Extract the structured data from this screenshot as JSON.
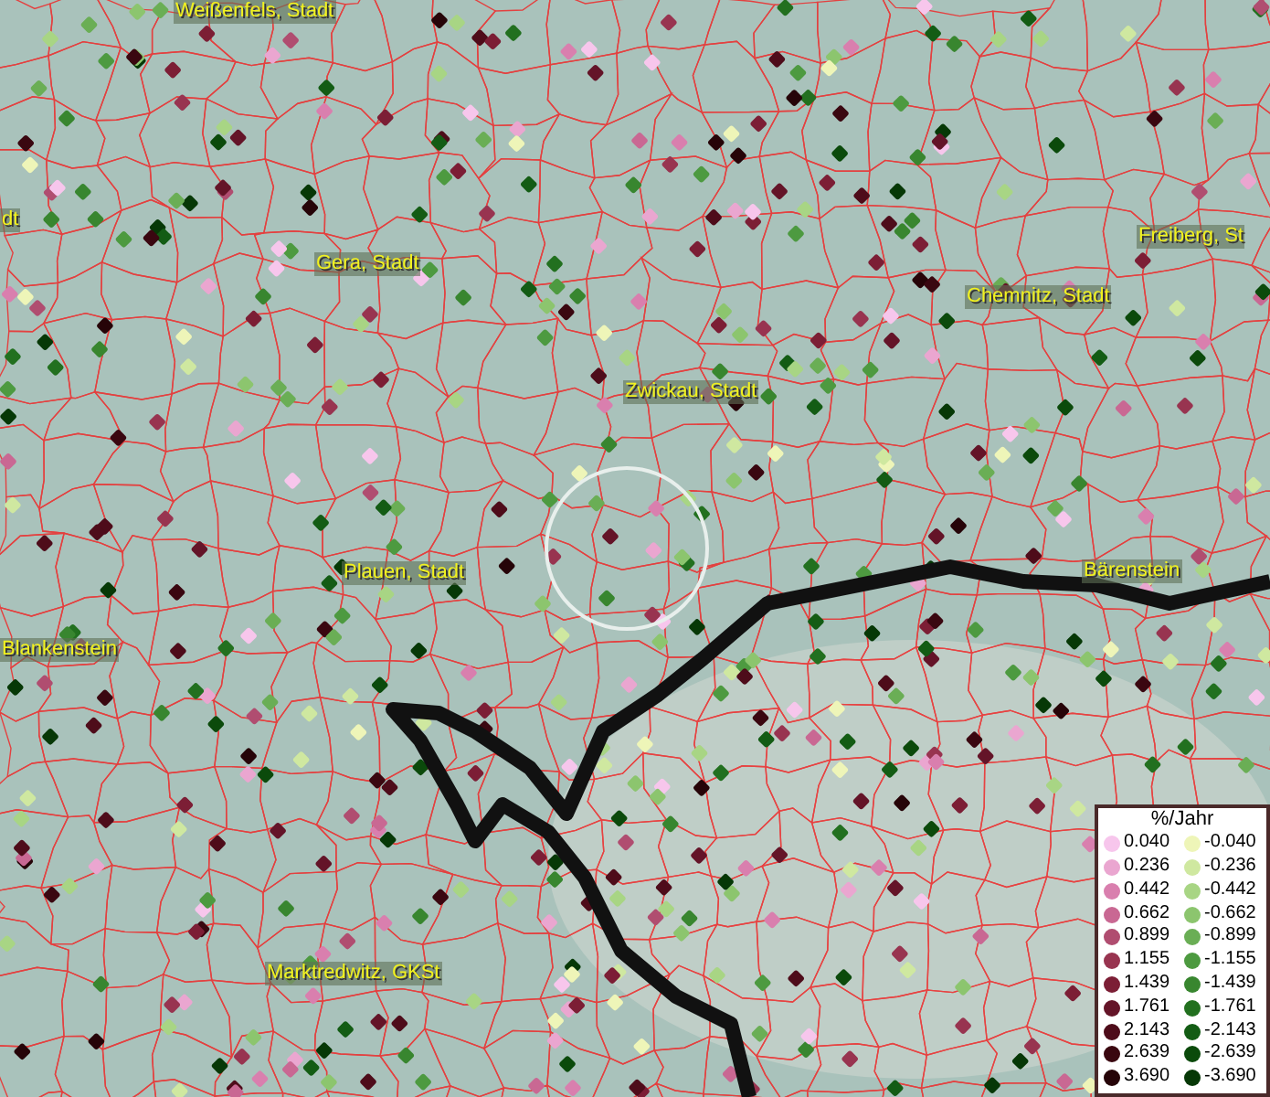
{
  "map_labels": [
    {
      "text": "Weißenfels, Stadt"
    },
    {
      "text": "dt"
    },
    {
      "text": "Gera, Stadt"
    },
    {
      "text": "Freiberg, St"
    },
    {
      "text": "Chemnitz, Stadt"
    },
    {
      "text": "Zwickau, Stadt"
    },
    {
      "text": "Plauen, Stadt"
    },
    {
      "text": "Blankenstein"
    },
    {
      "text": "Bärenstein"
    },
    {
      "text": "Marktredwitz, GKSt"
    }
  ],
  "legend": {
    "title": "%/Jahr",
    "rows": [
      {
        "positive": {
          "value": "0.040",
          "color": "#f7c6ec"
        },
        "negative": {
          "value": "-0.040",
          "color": "#eef5b8"
        }
      },
      {
        "positive": {
          "value": "0.236",
          "color": "#eaa6d0"
        },
        "negative": {
          "value": "-0.236",
          "color": "#cfe8a0"
        }
      },
      {
        "positive": {
          "value": "0.442",
          "color": "#d97fae"
        },
        "negative": {
          "value": "-0.442",
          "color": "#a8d584"
        }
      },
      {
        "positive": {
          "value": "0.662",
          "color": "#c96893"
        },
        "negative": {
          "value": "-0.662",
          "color": "#8cc56e"
        }
      },
      {
        "positive": {
          "value": "0.899",
          "color": "#b04d70"
        },
        "negative": {
          "value": "-0.899",
          "color": "#6aae55"
        }
      },
      {
        "positive": {
          "value": "1.155",
          "color": "#983450"
        },
        "negative": {
          "value": "-1.155",
          "color": "#4d9a40"
        }
      },
      {
        "positive": {
          "value": "1.439",
          "color": "#7c1e35"
        },
        "negative": {
          "value": "-1.439",
          "color": "#38862f"
        }
      },
      {
        "positive": {
          "value": "1.761",
          "color": "#641428"
        },
        "negative": {
          "value": "-1.761",
          "color": "#22701f"
        }
      },
      {
        "positive": {
          "value": "2.143",
          "color": "#4e0c1a"
        },
        "negative": {
          "value": "-2.143",
          "color": "#135c14"
        }
      },
      {
        "positive": {
          "value": "2.639",
          "color": "#3a0710"
        },
        "negative": {
          "value": "-2.639",
          "color": "#0b4a0b"
        }
      },
      {
        "positive": {
          "value": "3.690",
          "color": "#260408"
        },
        "negative": {
          "value": "-3.690",
          "color": "#063806"
        }
      }
    ]
  }
}
